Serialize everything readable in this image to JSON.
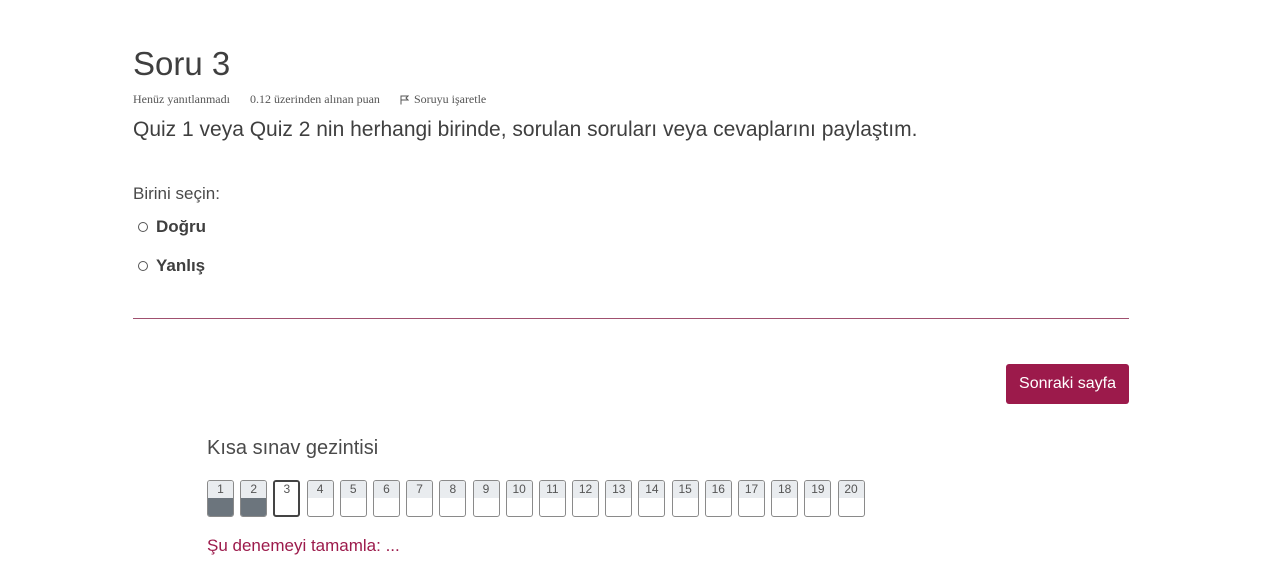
{
  "question": {
    "title": "Soru 3",
    "status": "Henüz yanıtlanmadı",
    "grade": "0.12 üzerinden alınan puan",
    "flag_label": "Soruyu işaretle",
    "text": "Quiz 1 veya Quiz 2 nin herhangi birinde, sorulan soruları veya cevaplarını paylaştım.",
    "prompt": "Birini seçin:",
    "options": [
      {
        "label": "Doğru",
        "selected": false
      },
      {
        "label": "Yanlış",
        "selected": false
      }
    ]
  },
  "actions": {
    "next_label": "Sonraki sayfa"
  },
  "navigation": {
    "title": "Kısa sınav gezintisi",
    "buttons": [
      {
        "label": "1",
        "state": "answered"
      },
      {
        "label": "2",
        "state": "answered"
      },
      {
        "label": "3",
        "state": "current"
      },
      {
        "label": "4",
        "state": "unanswered"
      },
      {
        "label": "5",
        "state": "unanswered"
      },
      {
        "label": "6",
        "state": "unanswered"
      },
      {
        "label": "7",
        "state": "unanswered"
      },
      {
        "label": "8",
        "state": "unanswered"
      },
      {
        "label": "9",
        "state": "unanswered"
      },
      {
        "label": "10",
        "state": "unanswered"
      },
      {
        "label": "11",
        "state": "unanswered"
      },
      {
        "label": "12",
        "state": "unanswered"
      },
      {
        "label": "13",
        "state": "unanswered"
      },
      {
        "label": "14",
        "state": "unanswered"
      },
      {
        "label": "15",
        "state": "unanswered"
      },
      {
        "label": "16",
        "state": "unanswered"
      },
      {
        "label": "17",
        "state": "unanswered"
      },
      {
        "label": "18",
        "state": "unanswered"
      },
      {
        "label": "19",
        "state": "unanswered"
      },
      {
        "label": "20",
        "state": "unanswered"
      }
    ],
    "finish_label": "Şu denemeyi tamamla: ..."
  },
  "colors": {
    "accent": "#9c1a4b",
    "answered_fill": "#6c757d"
  },
  "icons": {
    "flag": "flag-icon",
    "radio": "radio-icon"
  }
}
